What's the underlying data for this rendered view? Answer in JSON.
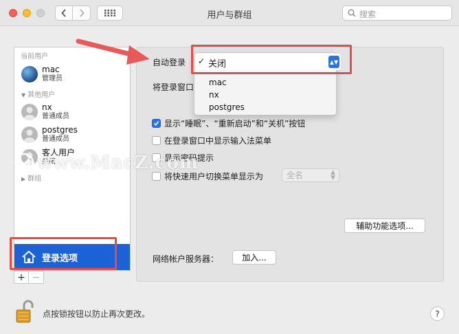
{
  "window": {
    "title": "用户与群组"
  },
  "search": {
    "placeholder": "搜索"
  },
  "sidebar": {
    "current_users_label": "当前用户",
    "current_user": {
      "name": "mac",
      "role": "管理员"
    },
    "other_users_label": "其他用户",
    "other_users": [
      {
        "name": "nx",
        "role": "普通成员"
      },
      {
        "name": "postgres",
        "role": "普通成员"
      },
      {
        "name": "客人用户",
        "role": "关闭"
      }
    ],
    "groups_label": "群组",
    "login_options_label": "登录选项",
    "add_label": "+",
    "remove_label": "−"
  },
  "main": {
    "auto_login_label": "自动登录",
    "auto_login_selected": "关闭",
    "auto_login_options": [
      "mac",
      "nx",
      "postgres"
    ],
    "login_window_label": "将登录窗口",
    "checkboxes": [
      {
        "label": "显示“睡眠”、“重新启动”和“关机”按钮",
        "checked": true
      },
      {
        "label": "在登录窗口中显示输入法菜单",
        "checked": false
      },
      {
        "label": "显示密码提示",
        "checked": false
      },
      {
        "label": "将快速用户切换菜单显示为",
        "checked": false
      }
    ],
    "fast_switch_value": "全名",
    "accessibility_button": "辅助功能选项...",
    "network_server_label": "网络帐户服务器：",
    "join_button": "加入..."
  },
  "watermark": {
    "text": "www.MacZ.com"
  },
  "footer": {
    "lock_text": "点按锁按钮以防止再次更改。",
    "help_label": "?"
  },
  "colors": {
    "accent": "#1a62d6",
    "highlight_box": "#e84a4a",
    "arrow": "#e85a5a"
  }
}
